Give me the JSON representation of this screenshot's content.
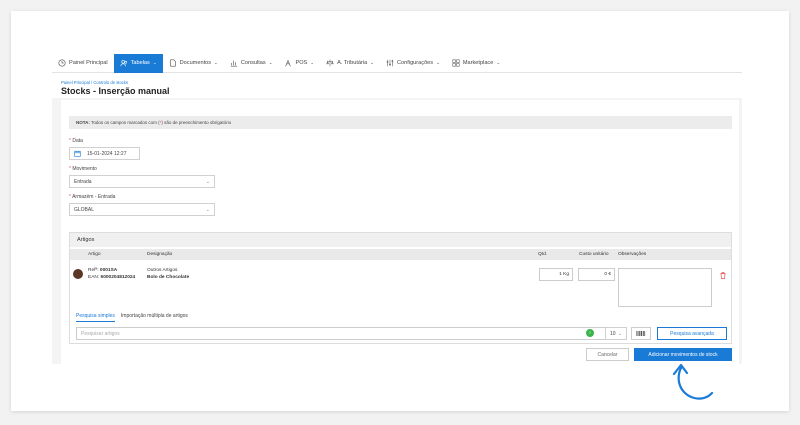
{
  "nav": {
    "items": [
      {
        "label": "Painel Principal",
        "icon": "clock-icon"
      },
      {
        "label": "Tabelas",
        "icon": "users-icon",
        "active": true
      },
      {
        "label": "Documentos",
        "icon": "document-icon"
      },
      {
        "label": "Consultas",
        "icon": "chart-icon"
      },
      {
        "label": "POS",
        "icon": "pos-icon"
      },
      {
        "label": "A. Tributária",
        "icon": "scale-icon"
      },
      {
        "label": "Configurações",
        "icon": "settings-icon"
      },
      {
        "label": "Marketplace",
        "icon": "shop-icon"
      }
    ]
  },
  "breadcrumb": {
    "home": "Painel Principal",
    "sep": "/",
    "current": "Controlo de stocks"
  },
  "page_title": "Stocks - Inserção manual",
  "note": {
    "label": "NOTA:",
    "text_before": "Todos os campos marcados com (",
    "star": "*",
    "text_after": ") são de preenchimento obrigatório"
  },
  "form": {
    "data_label": "Data",
    "data_value": "15-01-2024 12:27",
    "movimento_label": "Movimento",
    "movimento_value": "Entrada",
    "armazem_label": "Armazém - Entrada",
    "armazem_value": "GLOBAL",
    "required_mark": "*"
  },
  "artigos": {
    "title": "Artigos",
    "columns": {
      "artigo": "Artigo",
      "designacao": "Designação",
      "qtd": "Qtd.",
      "custo": "Custo unitário",
      "obs": "Observações"
    },
    "row": {
      "ref_label": "Refª:",
      "ref": "0001SA",
      "ean_label": "EAN:",
      "ean": "5000204812024",
      "group": "Outros Artigos",
      "name": "Bolo de Chocolate",
      "qty": "1 Kg",
      "cost": "0 €"
    },
    "tabs": {
      "simple": "Pesquisa simples",
      "multi": "Importação múltipla de artigos"
    },
    "search_placeholder": "Pesquisar artigos",
    "page_size": "10",
    "advanced_button": "Pesquisa avançada"
  },
  "actions": {
    "cancel": "Cancelar",
    "submit": "Adicionar movimentos de stock"
  },
  "colors": {
    "accent": "#1a7bd6",
    "go": "#3bb54a",
    "delete": "#e05050"
  }
}
